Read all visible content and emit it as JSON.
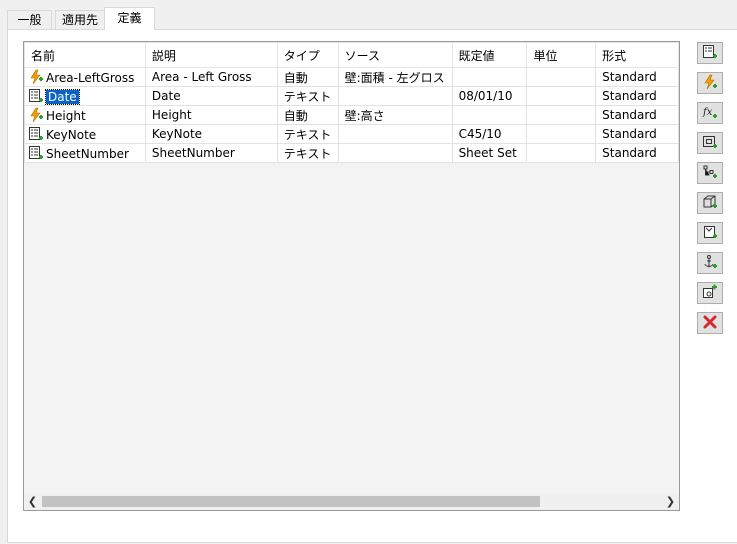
{
  "tabs": [
    {
      "label": "一般"
    },
    {
      "label": "適用先"
    },
    {
      "label": "定義"
    }
  ],
  "table": {
    "columns": [
      "名前",
      "説明",
      "タイプ",
      "ソース",
      "既定値",
      "単位",
      "形式"
    ],
    "rows": [
      {
        "icon": "lightning-icon",
        "cells": [
          "Area-LeftGross",
          "Area - Left Gross",
          "自動",
          "壁:面積 - 左グロス",
          "",
          "",
          "Standard"
        ]
      },
      {
        "icon": "text-property-icon",
        "cells": [
          "Date",
          "Date",
          "テキスト",
          "",
          "08/01/10",
          "",
          "Standard"
        ]
      },
      {
        "icon": "lightning-icon",
        "cells": [
          "Height",
          "Height",
          "自動",
          "壁:高さ",
          "",
          "",
          "Standard"
        ]
      },
      {
        "icon": "text-property-icon",
        "cells": [
          "KeyNote",
          "KeyNote",
          "テキスト",
          "",
          "C45/10",
          "",
          "Standard"
        ]
      },
      {
        "icon": "text-property-icon",
        "cells": [
          "SheetNumber",
          "SheetNumber",
          "テキスト",
          "",
          "Sheet Set",
          "",
          "Standard"
        ]
      }
    ],
    "selected_row": 1
  },
  "toolbar": [
    "add-text-property-icon",
    "add-auto-property-icon",
    "add-formula-property-icon",
    "add-location-property-icon",
    "add-classification-property-icon",
    "add-material-property-icon",
    "add-graphic-property-icon",
    "add-anchor-property-icon",
    "add-measurement-property-icon",
    "delete-icon"
  ],
  "colors": {
    "selection": "#0a64c8",
    "delete": "#d62a2a",
    "plus": "#2e9e2e",
    "lightning": "#f0a000"
  }
}
